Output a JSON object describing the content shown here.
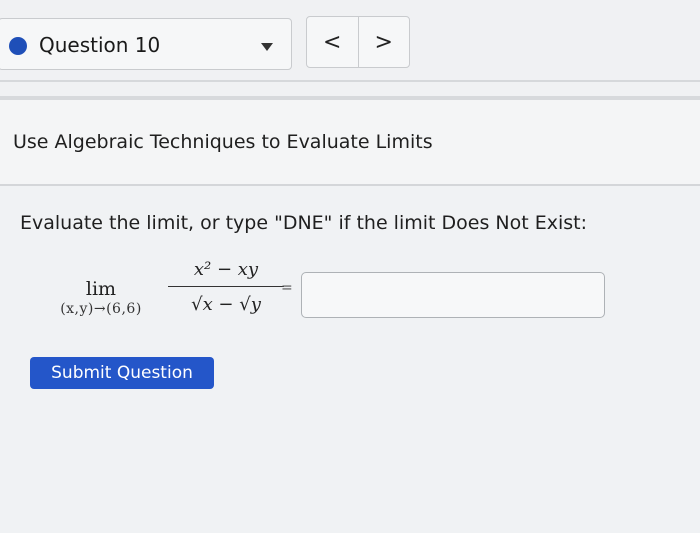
{
  "header": {
    "question_label": "Question 10",
    "prev_label": "<",
    "next_label": ">",
    "dot_icon": "filled-circle-icon",
    "caret_icon": "caret-down-icon"
  },
  "section": {
    "title": "Use Algebraic Techniques to Evaluate Limits"
  },
  "problem": {
    "prompt": "Evaluate the limit, or type \"DNE\" if the limit Does Not Exist:",
    "lim_word": "lim",
    "lim_subscript": "(x,y)→(6,6)",
    "numerator": "x² − xy",
    "denominator": "√x − √y",
    "equals": "=",
    "answer_value": ""
  },
  "actions": {
    "submit_label": "Submit Question"
  },
  "colors": {
    "accent": "#2456c9",
    "dot": "#1f4fb8"
  }
}
